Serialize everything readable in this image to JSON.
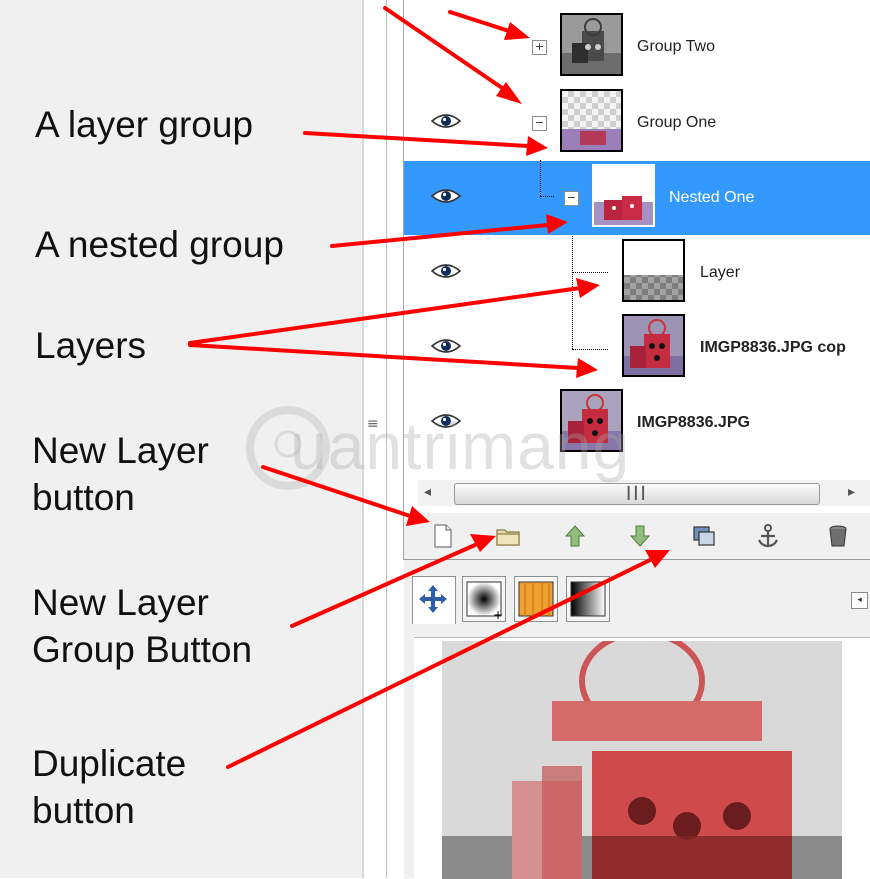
{
  "annotations": {
    "layer_group": "A layer group",
    "nested_group": "A nested group",
    "layers": "Layers",
    "new_layer_line1": "New Layer",
    "new_layer_line2": "button",
    "new_group_line1": "New Layer",
    "new_group_line2": "Group Button",
    "duplicate_line1": "Duplicate",
    "duplicate_line2": "button"
  },
  "layers": [
    {
      "name": "Group Two",
      "expander": "+",
      "visible": false,
      "selected": false
    },
    {
      "name": "Group One",
      "expander": "−",
      "visible": true,
      "selected": false
    },
    {
      "name": "Nested One",
      "expander": "−",
      "visible": true,
      "selected": true
    },
    {
      "name": "Layer",
      "expander": "",
      "visible": true,
      "selected": false
    },
    {
      "name": "IMGP8836.JPG cop",
      "expander": "",
      "visible": true,
      "selected": false
    },
    {
      "name": "IMGP8836.JPG",
      "expander": "",
      "visible": true,
      "selected": false
    }
  ],
  "toolbar": {
    "buttons": [
      "new-layer-icon",
      "new-layer-group-icon",
      "raise-layer-icon",
      "lower-layer-icon",
      "duplicate-layer-icon",
      "anchor-layer-icon",
      "delete-layer-icon"
    ]
  },
  "lower_tabs": [
    "move-tool-icon",
    "brush-icon",
    "pattern-icon",
    "gradient-icon"
  ],
  "watermark": {
    "text": "uantrimang"
  },
  "colors": {
    "selection": "#3399ff",
    "arrow": "#ff0000",
    "panel_bg": "#f0f0f0"
  }
}
